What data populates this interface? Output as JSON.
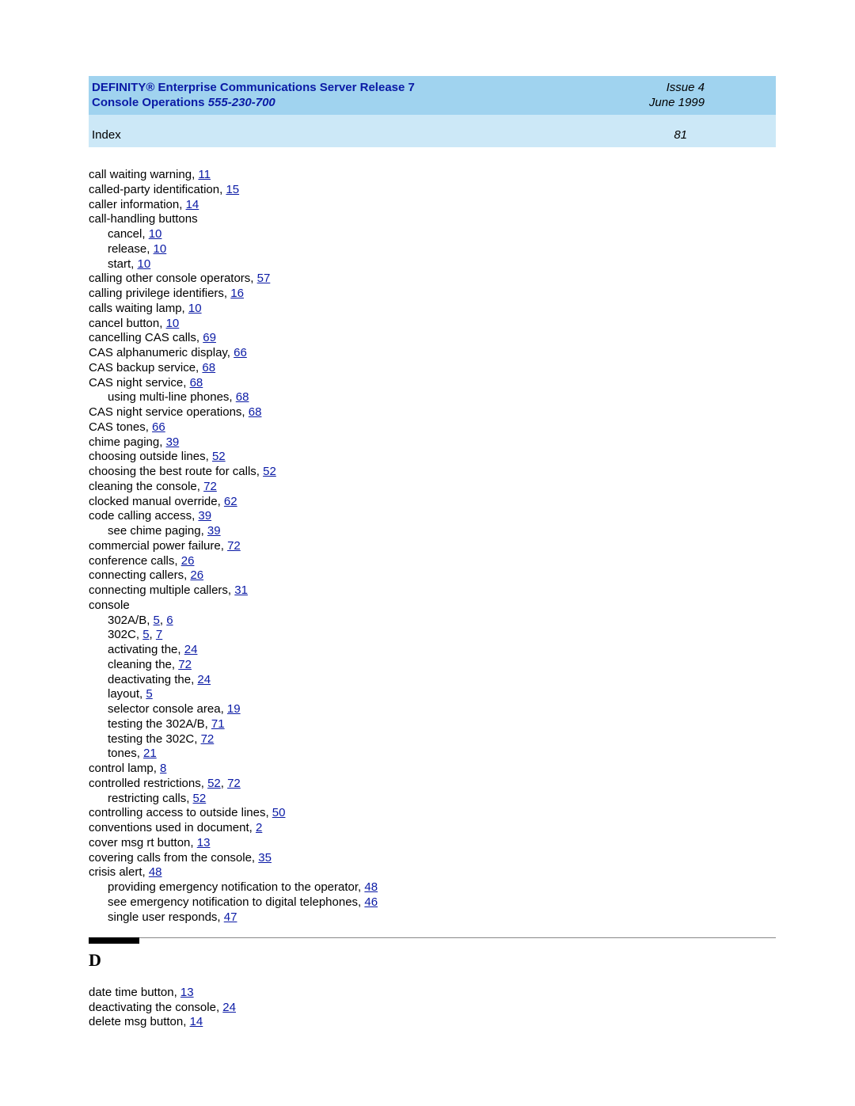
{
  "banner": {
    "title_line1": "DEFINITY® Enterprise Communications Server Release 7",
    "title_line2a": "Console Operations  ",
    "title_line2b": "555-230-700",
    "issue": "Issue 4",
    "date": "June 1999"
  },
  "subbanner": {
    "label": "Index",
    "pagenum": "81"
  },
  "section_d": "D",
  "entries_c": [
    {
      "t": "call waiting warning, ",
      "refs": [
        "11"
      ],
      "sub": false
    },
    {
      "t": "called-party identification, ",
      "refs": [
        "15"
      ],
      "sub": false
    },
    {
      "t": "caller information, ",
      "refs": [
        "14"
      ],
      "sub": false
    },
    {
      "t": "call-handling buttons",
      "refs": [],
      "sub": false
    },
    {
      "t": "cancel, ",
      "refs": [
        "10"
      ],
      "sub": true
    },
    {
      "t": "release, ",
      "refs": [
        "10"
      ],
      "sub": true
    },
    {
      "t": "start, ",
      "refs": [
        "10"
      ],
      "sub": true
    },
    {
      "t": "calling other console operators, ",
      "refs": [
        "57"
      ],
      "sub": false
    },
    {
      "t": "calling privilege identifiers, ",
      "refs": [
        "16"
      ],
      "sub": false
    },
    {
      "t": "calls waiting lamp, ",
      "refs": [
        "10"
      ],
      "sub": false
    },
    {
      "t": "cancel button, ",
      "refs": [
        "10"
      ],
      "sub": false
    },
    {
      "t": "cancelling CAS calls, ",
      "refs": [
        "69"
      ],
      "sub": false
    },
    {
      "t": "CAS alphanumeric display, ",
      "refs": [
        "66"
      ],
      "sub": false
    },
    {
      "t": "CAS backup service, ",
      "refs": [
        "68"
      ],
      "sub": false
    },
    {
      "t": "CAS night service, ",
      "refs": [
        "68"
      ],
      "sub": false
    },
    {
      "t": "using multi-line phones, ",
      "refs": [
        "68"
      ],
      "sub": true
    },
    {
      "t": "CAS night service operations, ",
      "refs": [
        "68"
      ],
      "sub": false
    },
    {
      "t": "CAS tones, ",
      "refs": [
        "66"
      ],
      "sub": false
    },
    {
      "t": "chime paging, ",
      "refs": [
        "39"
      ],
      "sub": false
    },
    {
      "t": "choosing outside lines, ",
      "refs": [
        "52"
      ],
      "sub": false
    },
    {
      "t": "choosing the best route for calls, ",
      "refs": [
        "52"
      ],
      "sub": false
    },
    {
      "t": "cleaning the console, ",
      "refs": [
        "72"
      ],
      "sub": false
    },
    {
      "t": "clocked manual override, ",
      "refs": [
        "62"
      ],
      "sub": false
    },
    {
      "t": "code calling access, ",
      "refs": [
        "39"
      ],
      "sub": false
    },
    {
      "t": "see chime paging, ",
      "refs": [
        "39"
      ],
      "sub": true
    },
    {
      "t": "commercial power failure, ",
      "refs": [
        "72"
      ],
      "sub": false
    },
    {
      "t": "conference calls, ",
      "refs": [
        "26"
      ],
      "sub": false
    },
    {
      "t": "connecting callers, ",
      "refs": [
        "26"
      ],
      "sub": false
    },
    {
      "t": "connecting multiple callers, ",
      "refs": [
        "31"
      ],
      "sub": false
    },
    {
      "t": "console",
      "refs": [],
      "sub": false
    },
    {
      "t": "302A/B, ",
      "refs": [
        "5",
        "6"
      ],
      "sub": true
    },
    {
      "t": "302C, ",
      "refs": [
        "5",
        "7"
      ],
      "sub": true
    },
    {
      "t": "activating the, ",
      "refs": [
        "24"
      ],
      "sub": true
    },
    {
      "t": "cleaning the, ",
      "refs": [
        "72"
      ],
      "sub": true
    },
    {
      "t": "deactivating the, ",
      "refs": [
        "24"
      ],
      "sub": true
    },
    {
      "t": "layout, ",
      "refs": [
        "5"
      ],
      "sub": true
    },
    {
      "t": "selector console area, ",
      "refs": [
        "19"
      ],
      "sub": true
    },
    {
      "t": "testing the 302A/B, ",
      "refs": [
        "71"
      ],
      "sub": true
    },
    {
      "t": "testing the 302C, ",
      "refs": [
        "72"
      ],
      "sub": true
    },
    {
      "t": "tones, ",
      "refs": [
        "21"
      ],
      "sub": true
    },
    {
      "t": "control lamp, ",
      "refs": [
        "8"
      ],
      "sub": false
    },
    {
      "t": "controlled restrictions, ",
      "refs": [
        "52",
        "72"
      ],
      "sub": false
    },
    {
      "t": "restricting calls, ",
      "refs": [
        "52"
      ],
      "sub": true
    },
    {
      "t": "controlling access to outside lines, ",
      "refs": [
        "50"
      ],
      "sub": false
    },
    {
      "t": "conventions used in document, ",
      "refs": [
        "2"
      ],
      "sub": false
    },
    {
      "t": "cover msg rt button, ",
      "refs": [
        "13"
      ],
      "sub": false
    },
    {
      "t": "covering calls from the console, ",
      "refs": [
        "35"
      ],
      "sub": false
    },
    {
      "t": "crisis alert, ",
      "refs": [
        "48"
      ],
      "sub": false
    },
    {
      "t": "providing emergency notification to the operator, ",
      "refs": [
        "48"
      ],
      "sub": true
    },
    {
      "t": "see emergency notification to digital telephones, ",
      "refs": [
        "46"
      ],
      "sub": true
    },
    {
      "t": "single user responds, ",
      "refs": [
        "47"
      ],
      "sub": true
    }
  ],
  "entries_d": [
    {
      "t": "date time button, ",
      "refs": [
        "13"
      ],
      "sub": false
    },
    {
      "t": "deactivating the console, ",
      "refs": [
        "24"
      ],
      "sub": false
    },
    {
      "t": "delete msg button, ",
      "refs": [
        "14"
      ],
      "sub": false
    }
  ]
}
